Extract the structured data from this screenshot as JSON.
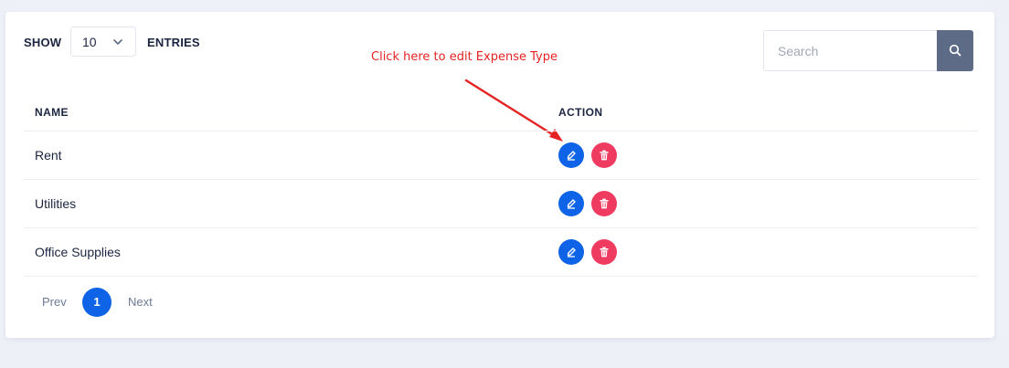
{
  "toolbar": {
    "show_label": "SHOW",
    "page_size": "10",
    "entries_label": "ENTRIES",
    "search_placeholder": "Search"
  },
  "annotation": {
    "text": "Click here to edit Expense Type"
  },
  "table": {
    "columns": [
      "NAME",
      "ACTION"
    ],
    "rows": [
      {
        "name": "Rent"
      },
      {
        "name": "Utilities"
      },
      {
        "name": "Office Supplies"
      }
    ]
  },
  "pagination": {
    "prev_label": "Prev",
    "current_page": "1",
    "next_label": "Next"
  },
  "colors": {
    "accent": "#0e63e6",
    "danger": "#ef3b5f",
    "search_button": "#5d6b86",
    "annotation": "#e52323"
  },
  "icons": {
    "dropdown": "chevron-down-icon",
    "search": "search-icon",
    "edit": "pencil-icon",
    "delete": "trash-icon"
  }
}
